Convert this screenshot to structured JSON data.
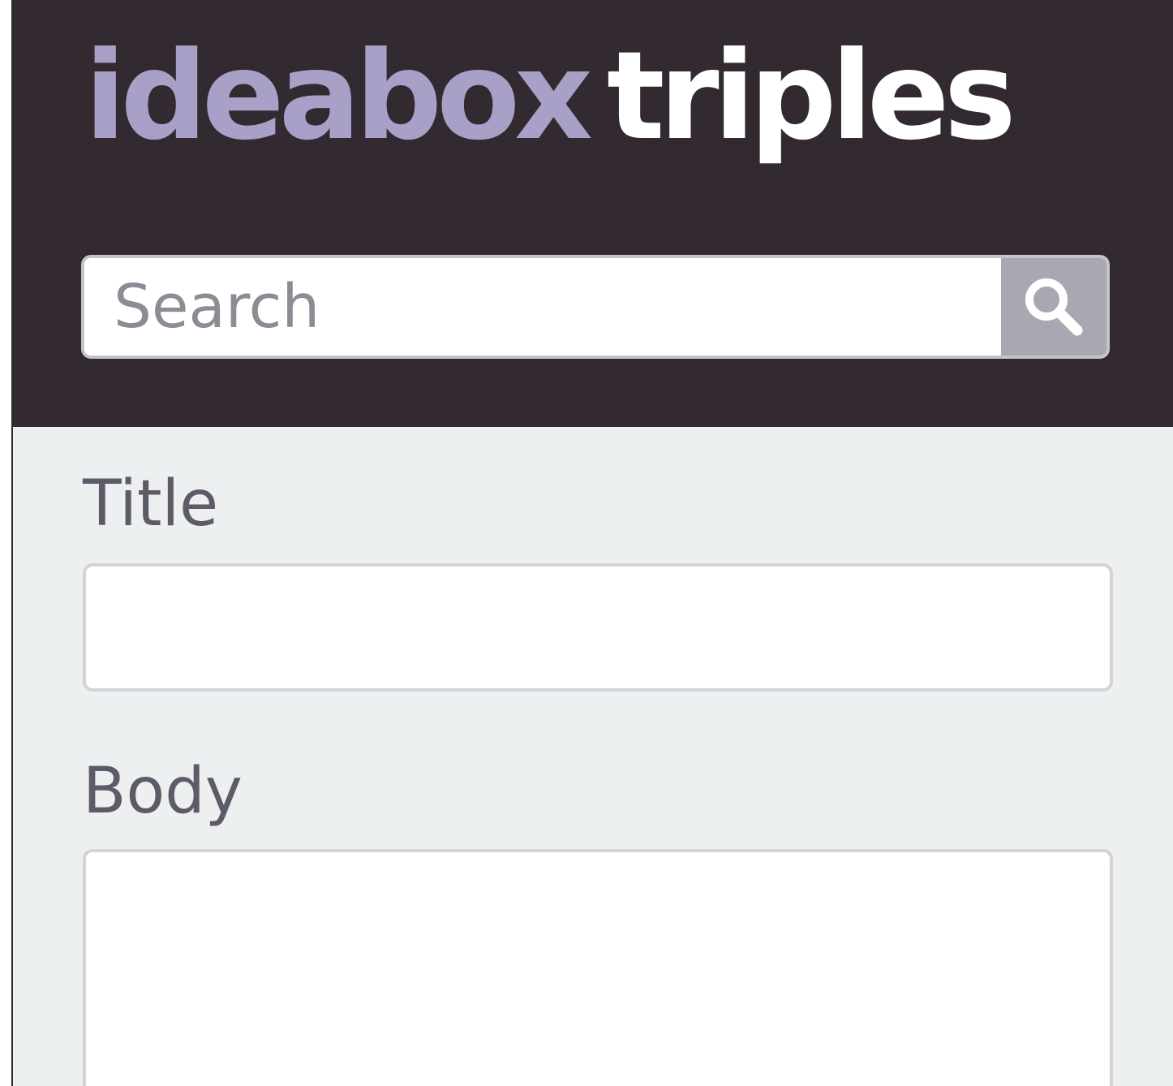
{
  "header": {
    "logo_part1": "ideabox",
    "logo_part2": "triples",
    "brand_colors": {
      "primary": "#a9a0c8",
      "secondary": "#ffffff",
      "header_bg": "#322a30"
    }
  },
  "search": {
    "placeholder": "Search",
    "value": "",
    "button_icon": "search-icon"
  },
  "form": {
    "title_label": "Title",
    "title_value": "",
    "body_label": "Body",
    "body_value": ""
  }
}
